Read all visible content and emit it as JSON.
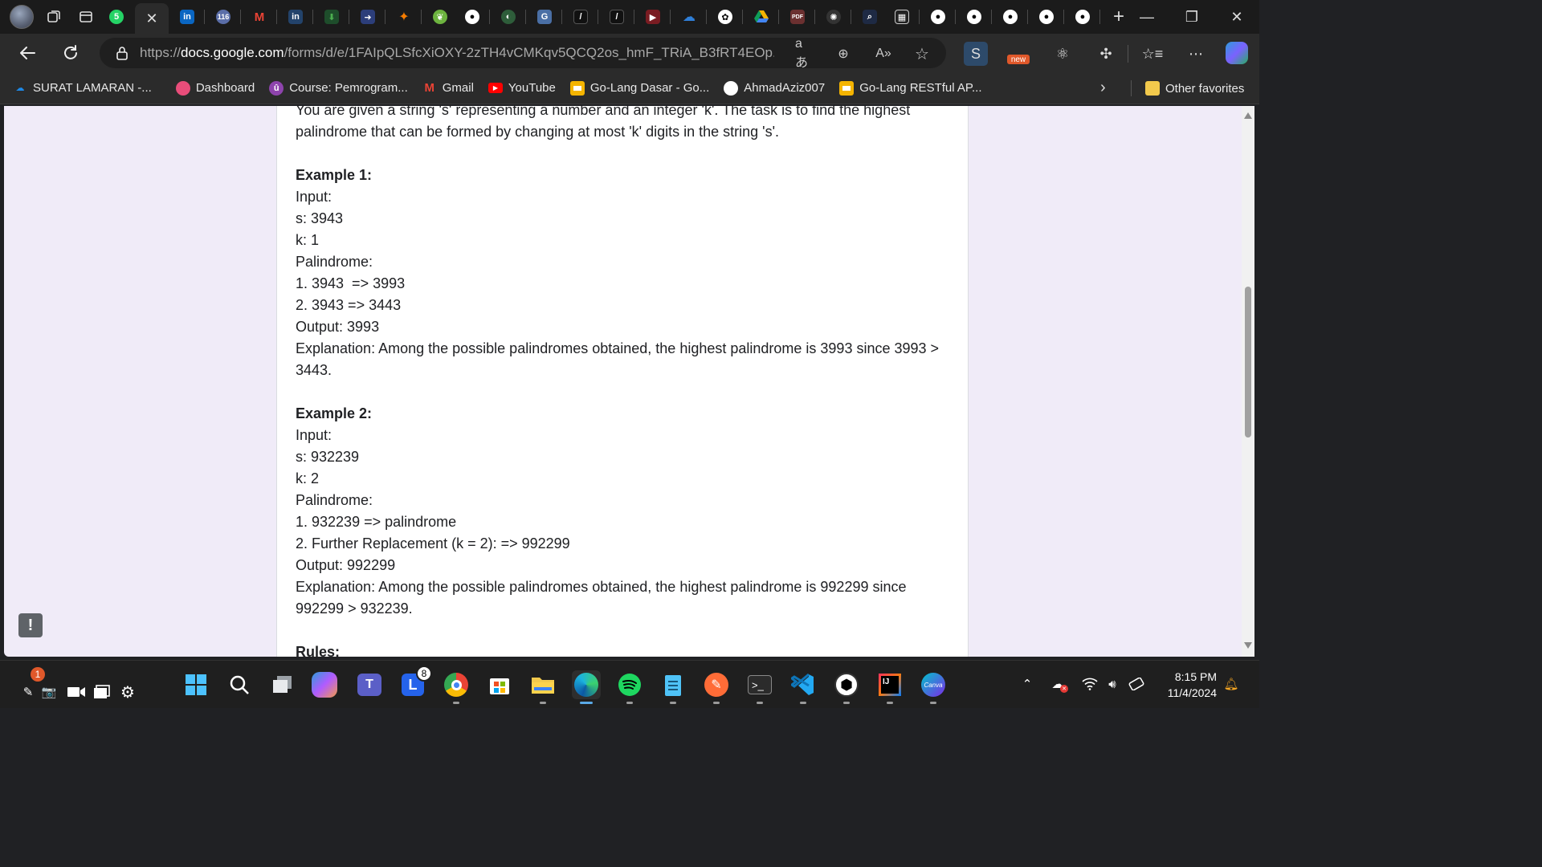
{
  "browser": {
    "url_prefix": "https://",
    "url_host": "docs.google.com",
    "url_path": "/forms/d/e/1FAIpQLSfcXiOXY-2zTH4vCMKqv5QCQ2os_hmF_TRiA_B3fRT4EOp...",
    "new_badge": "new",
    "bookmarks": [
      {
        "label": "SURAT LAMARAN -...",
        "icon": "onedrive-icon",
        "color": "#1e88e5"
      },
      {
        "label": "Dashboard",
        "icon": "dashboard-icon",
        "color": "#e84d7a"
      },
      {
        "label": "Course: Pemrogram...",
        "icon": "moodle-icon",
        "color": "#8e44ad"
      },
      {
        "label": "Gmail",
        "icon": "gmail-icon",
        "color": "#ea4335"
      },
      {
        "label": "YouTube",
        "icon": "youtube-icon",
        "color": "#ff0000"
      },
      {
        "label": "Go-Lang Dasar - Go...",
        "icon": "slides-icon",
        "color": "#f4b400"
      },
      {
        "label": "AhmadAziz007",
        "icon": "github-icon",
        "color": "#ffffff"
      },
      {
        "label": "Go-Lang RESTful AP...",
        "icon": "slides-icon",
        "color": "#f4b400"
      }
    ],
    "other_favorites": "Other favorites",
    "tab_badge_116": "116",
    "tab_badge_whatsapp": "5"
  },
  "doc": {
    "intro_line1": "You are given a string 's' representing a number and an integer 'k'. The task is to find the highest",
    "intro_line2": "palindrome that can be formed by changing at most 'k' digits in the string 's'.",
    "ex1_title": "Example 1:",
    "ex1_input": "Input:",
    "ex1_s": "s: 3943",
    "ex1_k": "k: 1",
    "ex1_pal": "Palindrome:",
    "ex1_p1": "1. 3943  => 3993",
    "ex1_p2": "2. 3943 => 3443",
    "ex1_out": "Output: 3993",
    "ex1_expl1": "Explanation: Among the possible palindromes obtained, the highest palindrome is 3993 since 3993 >",
    "ex1_expl2": "3443.",
    "ex2_title": "Example 2:",
    "ex2_input": "Input:",
    "ex2_s": "s: 932239",
    "ex2_k": "k: 2",
    "ex2_pal": "Palindrome:",
    "ex2_p1": "1. 932239 => palindrome",
    "ex2_p2": "2. Further Replacement (k = 2): => 992299",
    "ex2_out": "Output: 992299",
    "ex2_expl1": "Explanation: Among the possible palindromes obtained, the highest palindrome is 992299 since",
    "ex2_expl2": "992299 > 932239.",
    "rules_title": "Rules:",
    "feedback_glyph": "!"
  },
  "taskbar": {
    "notif_count": "1",
    "l_badge": "8",
    "time": "8:15 PM",
    "date": "11/4/2024"
  },
  "colors": {
    "page_bg": "#f0ebf8",
    "card_bg": "#ffffff",
    "text": "#202124",
    "chrome": "#2b2b2b"
  }
}
